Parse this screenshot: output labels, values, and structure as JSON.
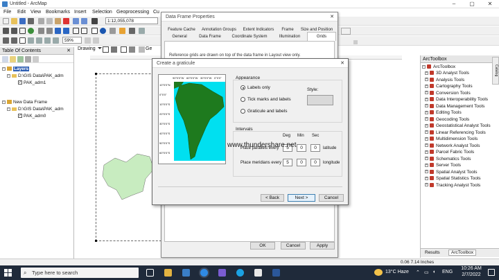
{
  "window": {
    "title": "Untitled - ArcMap"
  },
  "menu": [
    "File",
    "Edit",
    "View",
    "Bookmarks",
    "Insert",
    "Selection",
    "Geoprocessing",
    "Cu"
  ],
  "toolbar": {
    "scale": "1:12,055,078",
    "zoom": "59%",
    "drawing_label": "Drawing"
  },
  "toc": {
    "title": "Table Of Contents",
    "frame1": "Layers",
    "path1": "D:\\GIS Data\\PAK_adm",
    "layer1": "PAK_adm1",
    "frame2": "New Data Frame",
    "path2": "D:\\GIS Data\\PAK_adm",
    "layer2": "PAK_adm0"
  },
  "dfp": {
    "title": "Data Frame Properties",
    "tabs_row1": [
      "Feature Cache",
      "Annotation Groups",
      "Extent Indicators",
      "Frame",
      "Size and Position"
    ],
    "tabs_row2": [
      "General",
      "Data Frame",
      "Coordinate System",
      "Illumination",
      "Grids"
    ],
    "desc": "Reference grids are drawn on top of the data frame in Layout view only.",
    "ok": "OK",
    "cancel": "Cancel",
    "apply": "Apply"
  },
  "graticule": {
    "title": "Create a graticule",
    "appearance_label": "Appearance",
    "options": [
      "Labels only",
      "Tick marks and labels",
      "Graticule and labels"
    ],
    "style_label": "Style:",
    "intervals_label": "Intervals",
    "col_deg": "Deg",
    "col_min": "Min",
    "col_sec": "Sec",
    "parallels_label": "Place parallels every",
    "parallels": [
      "5",
      "0",
      "0"
    ],
    "parallels_unit": "latitude",
    "meridians_label": "Place meridians every",
    "meridians": [
      "5",
      "0",
      "0"
    ],
    "meridians_unit": "longitude",
    "back": "< Back",
    "next": "Next >",
    "cancel": "Cancel",
    "preview_lon": [
      "90°0'0\"W",
      "60°0'0\"W",
      "30°0'0\"W",
      "0°0'0\""
    ],
    "preview_lat": [
      "10°0'0\"N",
      "0°0'0\"",
      "10°0'0\"S",
      "20°0'0\"S",
      "30°0'0\"S",
      "40°0'0\"S",
      "50°0'0\"S",
      "60°0'0\"S"
    ]
  },
  "watermark": "www.thundershare.net",
  "arctoolbox": {
    "title": "ArcToolbox",
    "root": "ArcToolbox",
    "items": [
      "3D Analyst Tools",
      "Analysis Tools",
      "Cartography Tools",
      "Conversion Tools",
      "Data Interoperability Tools",
      "Data Management Tools",
      "Editing Tools",
      "Geocoding Tools",
      "Geostatistical Analyst Tools",
      "Linear Referencing Tools",
      "Multidimension Tools",
      "Network Analyst Tools",
      "Parcel Fabric Tools",
      "Schematics Tools",
      "Server Tools",
      "Spatial Analyst Tools",
      "Spatial Statistics Tools",
      "Tracking Analyst Tools"
    ],
    "tab_results": "Results",
    "tab_toolbox": "ArcToolbox",
    "side_tab": "Catalog"
  },
  "status": {
    "coords": "0.06  7.14 Inches"
  },
  "taskbar": {
    "search_placeholder": "Type here to search",
    "weather": "13°C  Haze",
    "lang": "ENG",
    "time": "10:26 AM",
    "date": "2/7/2022"
  },
  "colors": {
    "land": "#c8ecc0",
    "ocean": "#00e0f0",
    "south_america": "#1e7a1e",
    "dialog": "#f0f0f0",
    "taskbar": "#1f2a3a"
  }
}
